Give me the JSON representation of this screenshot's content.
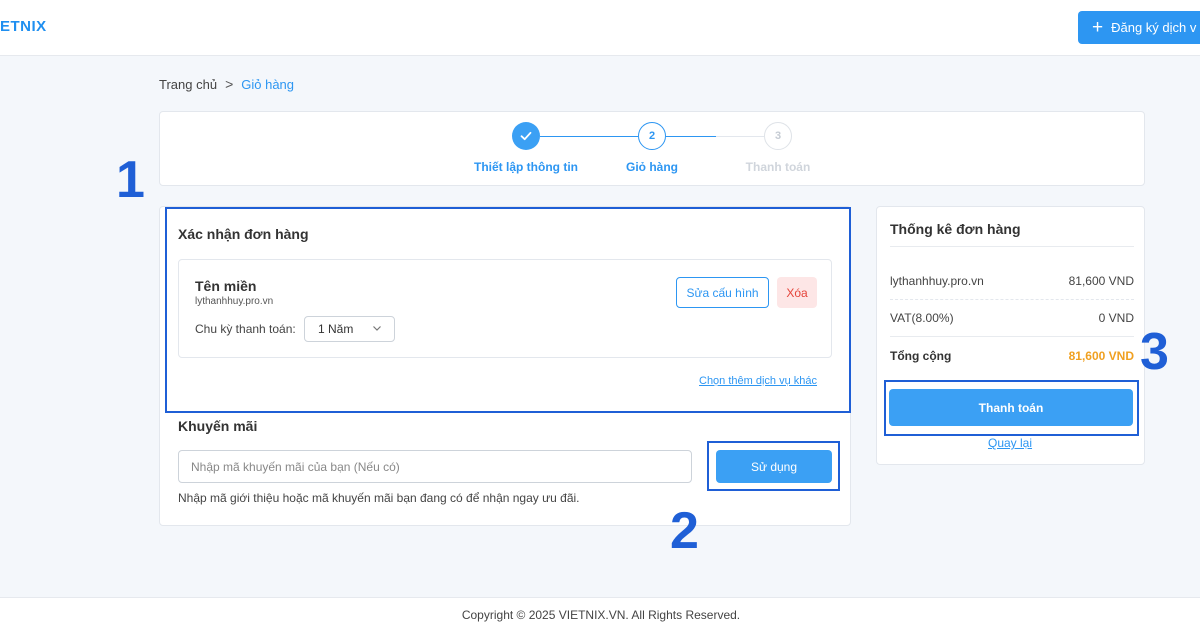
{
  "header": {
    "logo": "ETNIX",
    "register_label": "Đăng ký dịch v"
  },
  "breadcrumb": {
    "home": "Trang chủ",
    "separator": ">",
    "current": "Giỏ hàng"
  },
  "stepper": {
    "steps": [
      {
        "label": "Thiết lập thông tin",
        "number": "1",
        "state": "done"
      },
      {
        "label": "Giỏ hàng",
        "number": "2",
        "state": "active"
      },
      {
        "label": "Thanh toán",
        "number": "3",
        "state": "pending"
      }
    ]
  },
  "order": {
    "title": "Xác nhận đơn hàng",
    "item": {
      "title": "Tên miền",
      "domain": "lythanhhuy.pro.vn",
      "cycle_label": "Chu kỳ thanh toán:",
      "cycle_value": "1 Năm",
      "edit_label": "Sửa cấu hình",
      "delete_label": "Xóa"
    },
    "more_services": "Chọn thêm dịch vụ khác"
  },
  "promo": {
    "title": "Khuyến mãi",
    "placeholder": "Nhập mã khuyến mãi của bạn (Nếu có)",
    "apply_label": "Sử dụng",
    "hint": "Nhập mã giới thiệu hoặc mã khuyến mãi bạn đang có để nhận ngay ưu đãi."
  },
  "summary": {
    "title": "Thống kê đơn hàng",
    "rows": [
      {
        "label": "lythanhhuy.pro.vn",
        "value": "81,600 VND"
      },
      {
        "label": "VAT(8.00%)",
        "value": "0 VND"
      }
    ],
    "total_label": "Tổng cộng",
    "total_value": "81,600 VND",
    "pay_label": "Thanh toán",
    "back_label": "Quay lại"
  },
  "annotations": [
    "1",
    "2",
    "3"
  ],
  "footer": {
    "copyright": "Copyright © 2025 VIETNIX.VN. All Rights Reserved."
  },
  "colors": {
    "primary": "#2d96f2",
    "annotation": "#1f5fd6",
    "total": "#f0a020",
    "danger": "#e5443a"
  }
}
